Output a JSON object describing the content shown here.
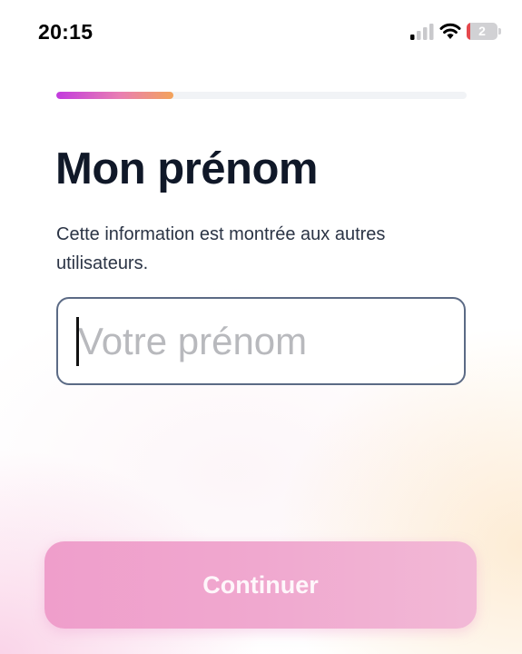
{
  "status_bar": {
    "time": "20:15",
    "battery_level": "2",
    "icons": [
      "cellular-signal-icon",
      "wifi-icon",
      "battery-icon"
    ]
  },
  "progress": {
    "value_fraction": 0.285
  },
  "main": {
    "title": "Mon prénom",
    "subtitle": "Cette information est montrée aux autres utilisateurs."
  },
  "name_input": {
    "placeholder": "Votre prénom",
    "value": ""
  },
  "continue_button": {
    "label": "Continuer"
  },
  "colors": {
    "progress_start": "#c23bde",
    "progress_end": "#f3a35a",
    "button": "#ef9ecb",
    "title": "#101828",
    "input_border": "#5b6a85",
    "battery_low": "#e5484d"
  }
}
